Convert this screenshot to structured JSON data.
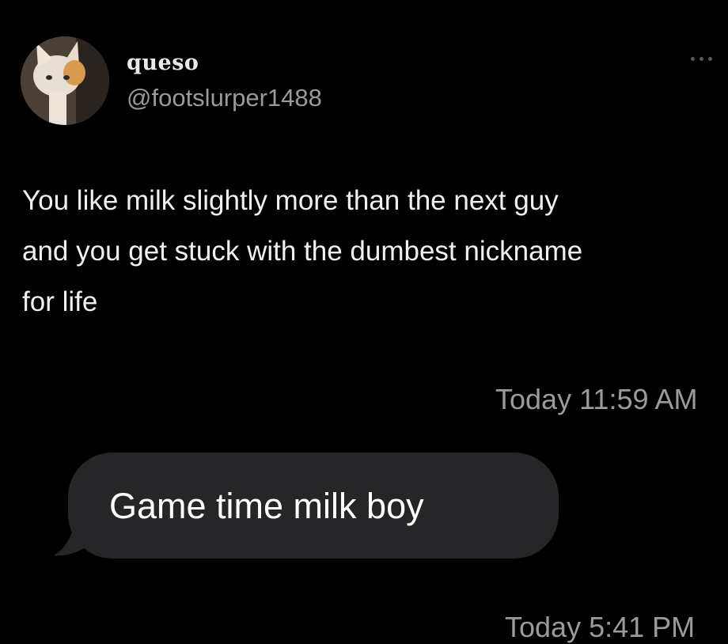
{
  "tweet": {
    "display_name": "queso",
    "handle": "@footslurper1488",
    "text": "You like milk slightly more than the next guy\nand you get stuck with the dumbest nickname\nfor life",
    "more_icon": "more-dots-icon"
  },
  "messages": {
    "timestamp_1": "Today 11:59 AM",
    "bubble_text": "Game time milk boy",
    "timestamp_2": "Today 5:41 PM"
  },
  "colors": {
    "background": "#000000",
    "bubble": "#262628",
    "secondary_text": "#9b9b9b"
  }
}
